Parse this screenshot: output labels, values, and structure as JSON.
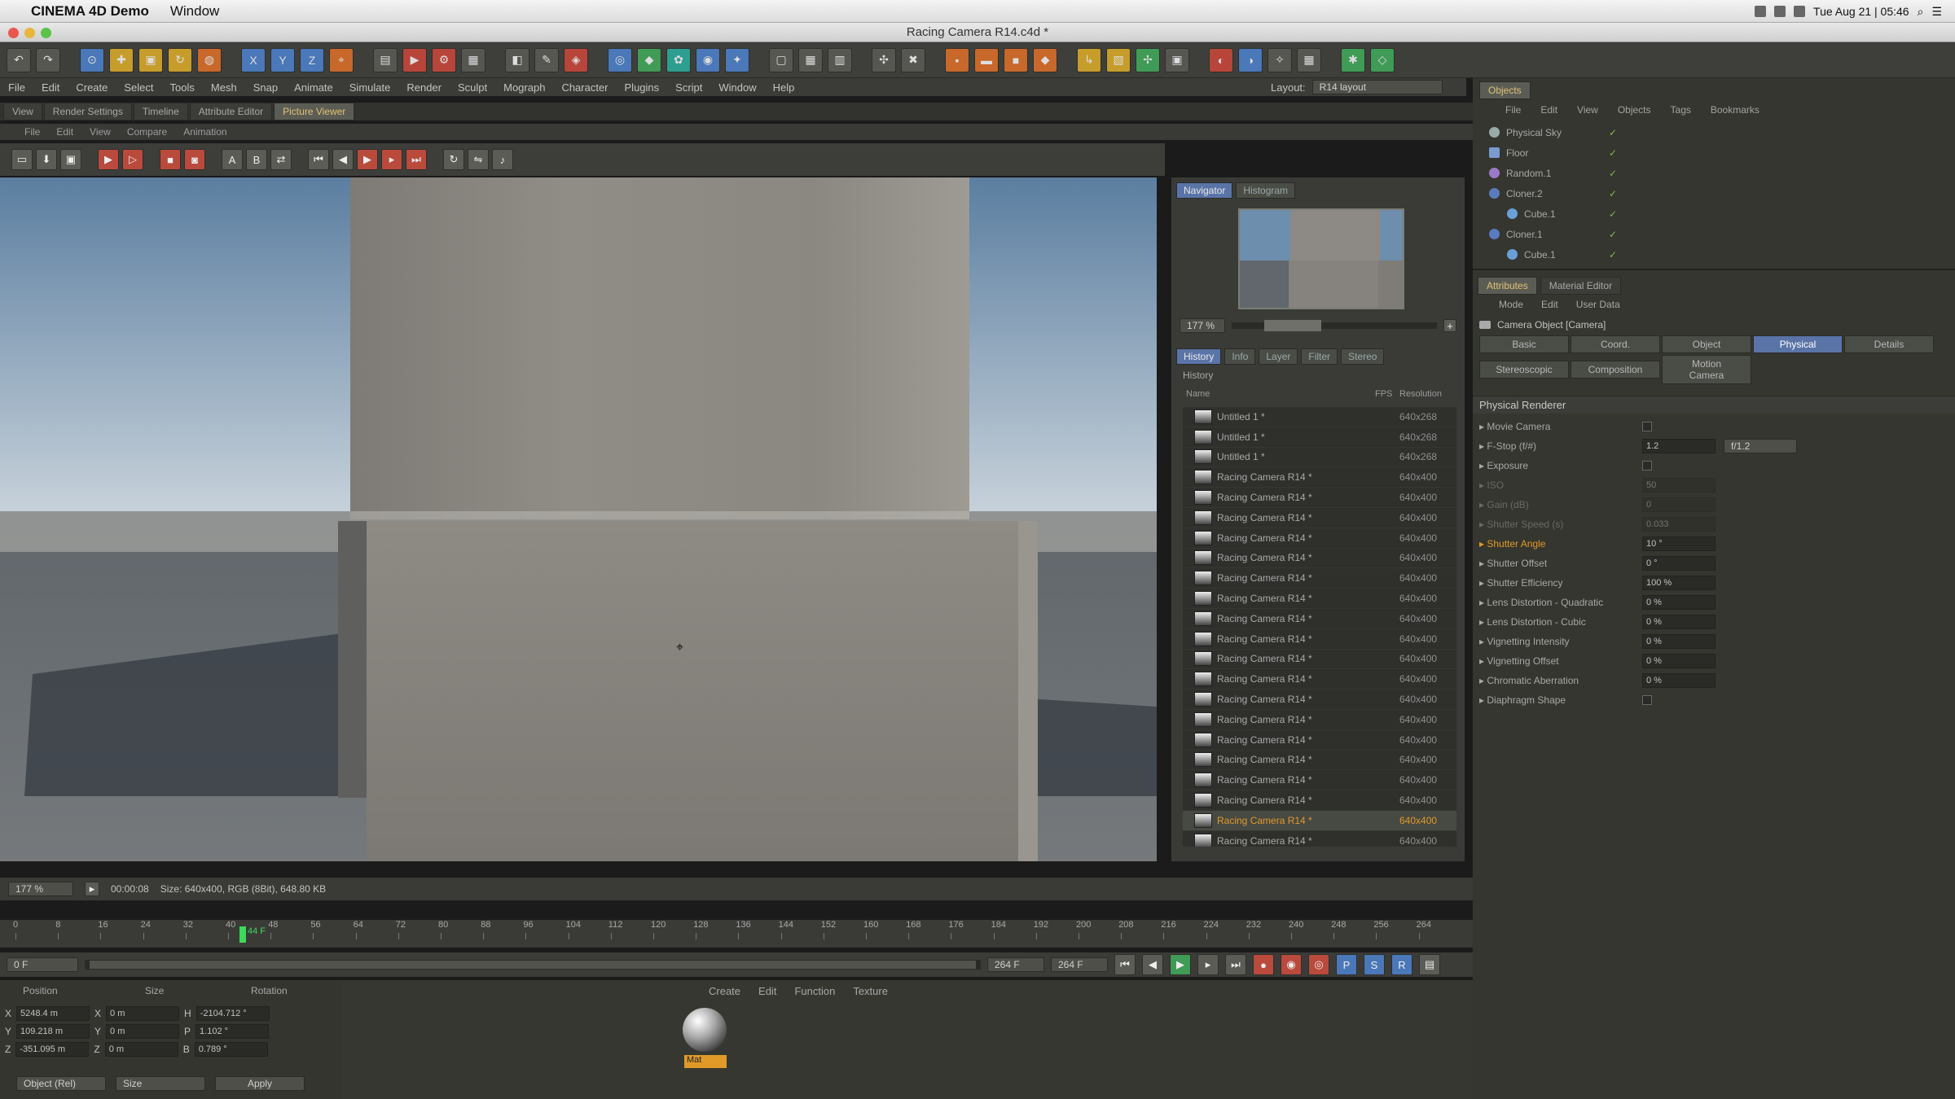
{
  "menubar": {
    "app": "CINEMA 4D Demo",
    "window": "Window",
    "datetime": "Tue Aug 21 | 05:46"
  },
  "window_title": "Racing Camera R14.c4d *",
  "main_menu": [
    "File",
    "Edit",
    "Create",
    "Select",
    "Tools",
    "Mesh",
    "Snap",
    "Animate",
    "Simulate",
    "Render",
    "Sculpt",
    "Mograph",
    "Character",
    "Plugins",
    "Script",
    "Window",
    "Help"
  ],
  "layout": {
    "label": "Layout:",
    "value": "R14 layout"
  },
  "manager_tabs": [
    "View",
    "Render Settings",
    "Timeline",
    "Attribute Editor",
    "Picture Viewer"
  ],
  "pv_menu": [
    "File",
    "Edit",
    "View",
    "Compare",
    "Animation"
  ],
  "navigator": {
    "tabs": [
      "Navigator",
      "Histogram"
    ],
    "zoom": "177 %",
    "sub_tabs": [
      "History",
      "Info",
      "Layer",
      "Filter",
      "Stereo"
    ],
    "history_label": "History",
    "col_name": "Name",
    "col_fps": "FPS",
    "col_res": "Resolution"
  },
  "history": [
    {
      "name": "Untitled 1 *",
      "res": "640x268"
    },
    {
      "name": "Untitled 1 *",
      "res": "640x268"
    },
    {
      "name": "Untitled 1 *",
      "res": "640x268"
    },
    {
      "name": "Racing Camera R14 *",
      "res": "640x400"
    },
    {
      "name": "Racing Camera R14 *",
      "res": "640x400"
    },
    {
      "name": "Racing Camera R14 *",
      "res": "640x400"
    },
    {
      "name": "Racing Camera R14 *",
      "res": "640x400"
    },
    {
      "name": "Racing Camera R14 *",
      "res": "640x400"
    },
    {
      "name": "Racing Camera R14 *",
      "res": "640x400"
    },
    {
      "name": "Racing Camera R14 *",
      "res": "640x400"
    },
    {
      "name": "Racing Camera R14 *",
      "res": "640x400"
    },
    {
      "name": "Racing Camera R14 *",
      "res": "640x400"
    },
    {
      "name": "Racing Camera R14 *",
      "res": "640x400"
    },
    {
      "name": "Racing Camera R14 *",
      "res": "640x400"
    },
    {
      "name": "Racing Camera R14 *",
      "res": "640x400"
    },
    {
      "name": "Racing Camera R14 *",
      "res": "640x400"
    },
    {
      "name": "Racing Camera R14 *",
      "res": "640x400"
    },
    {
      "name": "Racing Camera R14 *",
      "res": "640x400"
    },
    {
      "name": "Racing Camera R14 *",
      "res": "640x400"
    },
    {
      "name": "Racing Camera R14 *",
      "res": "640x400"
    },
    {
      "name": "Racing Camera R14 *",
      "res": "640x400",
      "selected": true
    },
    {
      "name": "Racing Camera R14 *",
      "res": "640x400"
    }
  ],
  "status": {
    "zoom": "177 %",
    "time": "00:00:08",
    "size": "Size: 640x400, RGB (8Bit), 648.80 KB"
  },
  "objects": {
    "panel_tab": "Objects",
    "menu": [
      "File",
      "Edit",
      "View",
      "Objects",
      "Tags",
      "Bookmarks"
    ],
    "items": [
      "Physical Sky",
      "Floor",
      "Random.1",
      "Cloner.2",
      "Cube.1",
      "Cloner.1",
      "Cube.1"
    ]
  },
  "attributes": {
    "tabs": [
      "Attributes",
      "Material Editor"
    ],
    "menu": [
      "Mode",
      "Edit",
      "User Data"
    ],
    "object": "Camera Object [Camera]",
    "sub_tabs_row1": [
      "Basic",
      "Coord.",
      "Object",
      "Physical",
      "Details"
    ],
    "sub_tabs_row2": [
      "Stereoscopic",
      "Composition",
      "Motion Camera"
    ],
    "section": "Physical Renderer",
    "params": [
      {
        "label": "Movie Camera",
        "val": ""
      },
      {
        "label": "F-Stop (f/#)",
        "val": "1.2",
        "extra": "f/1.2"
      },
      {
        "label": "Exposure",
        "val": ""
      },
      {
        "label": "ISO",
        "val": "50",
        "dis": true
      },
      {
        "label": "Gain (dB)",
        "val": "0",
        "dis": true
      },
      {
        "label": "Shutter Speed (s)",
        "val": "0.033",
        "dis": true
      },
      {
        "label": "Shutter Angle",
        "val": "10 °",
        "hl": true
      },
      {
        "label": "Shutter Offset",
        "val": "0 °"
      },
      {
        "label": "Shutter Efficiency",
        "val": "100 %"
      },
      {
        "label": "Lens Distortion - Quadratic",
        "val": "0 %"
      },
      {
        "label": "Lens Distortion - Cubic",
        "val": "0 %"
      },
      {
        "label": "Vignetting Intensity",
        "val": "0 %"
      },
      {
        "label": "Vignetting Offset",
        "val": "0 %"
      },
      {
        "label": "Chromatic Aberration",
        "val": "0 %"
      },
      {
        "label": "Diaphragm Shape",
        "val": ""
      }
    ]
  },
  "timeline": {
    "ticks": [
      "0",
      "8",
      "16",
      "24",
      "32",
      "40",
      "48",
      "56",
      "64",
      "72",
      "80",
      "88",
      "96",
      "104",
      "112",
      "120",
      "128",
      "136",
      "144",
      "152",
      "160",
      "168",
      "176",
      "184",
      "192",
      "200",
      "208",
      "216",
      "224",
      "232",
      "240",
      "248",
      "256",
      "264"
    ],
    "current": "44 F",
    "start": "0 F",
    "end": "264 F",
    "end2": "264 F"
  },
  "coords": {
    "headers": [
      "Position",
      "Size",
      "Rotation"
    ],
    "rows": [
      {
        "axis": "X",
        "pos": "5248.4 m",
        "size": "0 m",
        "rl": "H",
        "rot": "-2104.712 °"
      },
      {
        "axis": "Y",
        "pos": "109.218 m",
        "size": "0 m",
        "rl": "P",
        "rot": "1.102 °"
      },
      {
        "axis": "Z",
        "pos": "-351.095 m",
        "size": "0 m",
        "rl": "B",
        "rot": "0.789 °"
      }
    ],
    "mode": "Object (Rel)",
    "size_mode": "Size",
    "apply": "Apply"
  },
  "material": {
    "menu": [
      "Create",
      "Edit",
      "Function",
      "Texture"
    ],
    "name": "Mat"
  },
  "colors": {
    "accent": "#e19a28",
    "selection": "#5a74a8"
  }
}
